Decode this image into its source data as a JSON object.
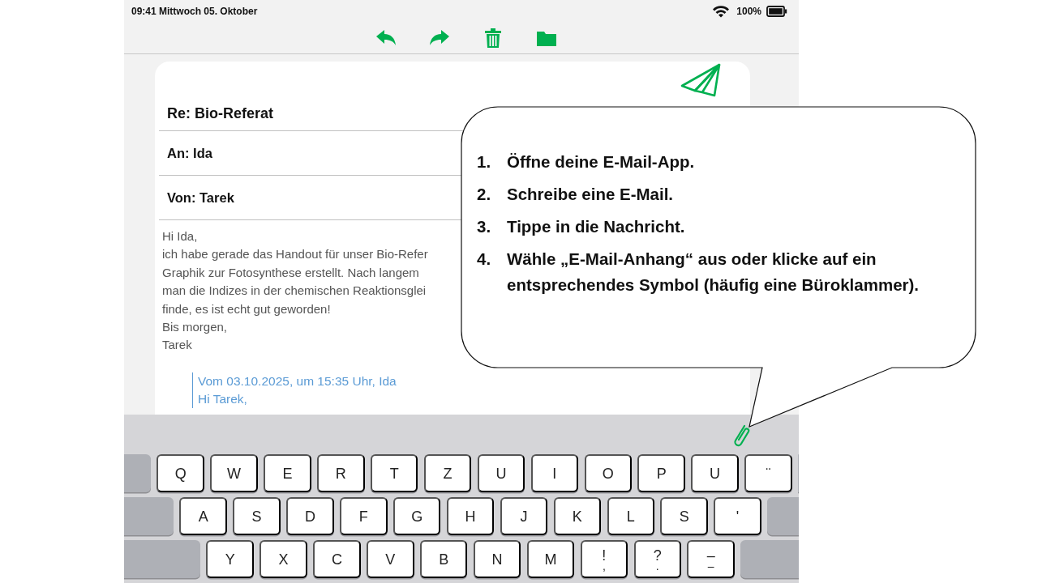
{
  "status_bar": {
    "time_date": "09:41 Mittwoch 05. Oktober",
    "battery": "100%"
  },
  "mail": {
    "subject": "Re: Bio-Referat",
    "to": "An: Ida",
    "from": "Von: Tarek",
    "body_lines": [
      "Hi Ida,",
      "ich habe gerade das Handout für unser Bio-Refer",
      "Graphik zur Fotosynthese erstellt. Nach langem",
      "man die Indizes in der chemischen Reaktionsglei",
      "finde, es ist echt gut geworden!",
      "Bis morgen,",
      "Tarek"
    ],
    "quote_lines": [
      "Vom 03.10.2025, um 15:35 Uhr, Ida",
      "Hi Tarek,"
    ]
  },
  "keyboard": {
    "rows": [
      {
        "keys": [
          {
            "label": "Q"
          },
          {
            "label": "W"
          },
          {
            "label": "E"
          },
          {
            "label": "R"
          },
          {
            "label": "T"
          },
          {
            "label": "Z"
          },
          {
            "label": "U"
          },
          {
            "label": "I"
          },
          {
            "label": "O"
          },
          {
            "label": "P"
          },
          {
            "label": "U"
          },
          {
            "label": "¨"
          }
        ]
      },
      {
        "keys": [
          {
            "label": "A"
          },
          {
            "label": "S"
          },
          {
            "label": "D"
          },
          {
            "label": "F"
          },
          {
            "label": "G"
          },
          {
            "label": "H"
          },
          {
            "label": "J"
          },
          {
            "label": "K"
          },
          {
            "label": "L"
          },
          {
            "label": "S"
          },
          {
            "label": "'"
          }
        ]
      },
      {
        "keys": [
          {
            "label": "Y"
          },
          {
            "label": "X"
          },
          {
            "label": "C"
          },
          {
            "label": "V"
          },
          {
            "label": "B"
          },
          {
            "label": "N"
          },
          {
            "label": "M"
          },
          {
            "label": "!",
            "sub": ","
          },
          {
            "label": "?",
            "sub": "."
          },
          {
            "label": "–",
            "sub": "–"
          }
        ]
      }
    ]
  },
  "callout": {
    "steps": [
      {
        "number": "1.",
        "text": "Öffne deine E-Mail-App."
      },
      {
        "number": "2.",
        "text": "Schreibe eine E-Mail."
      },
      {
        "number": "3.",
        "text": "Tippe in die Nachricht."
      },
      {
        "number": "4.",
        "text": "Wähle „E-Mail-Anhang“ aus oder klicke auf ein entsprechendes Symbol (häufig eine Büroklammer)."
      }
    ]
  }
}
